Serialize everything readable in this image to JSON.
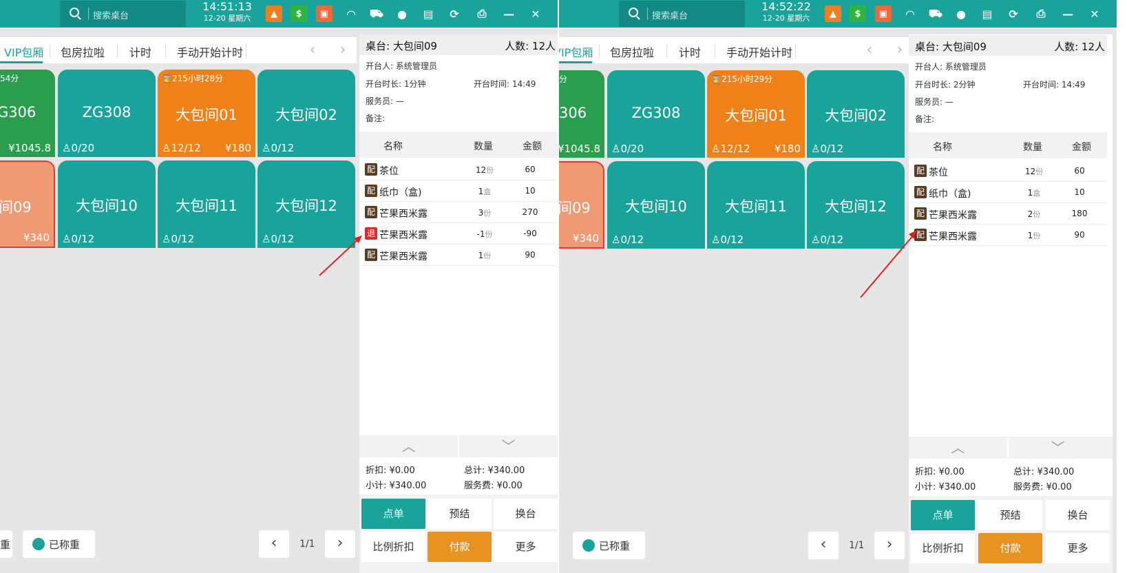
{
  "screens": [
    {
      "search_placeholder": "搜索桌台",
      "time": "14:51:13",
      "date": "12-20 星期六",
      "category_tabs": [
        "VIP包厢",
        "包房拉啦",
        "计时",
        "手动开始计时"
      ],
      "tiles": [
        {
          "name": "G306",
          "timer": "54分",
          "people": "",
          "amount": "¥1045.8"
        },
        {
          "name": "ZG308",
          "timer": "",
          "people": "0/20",
          "amount": ""
        },
        {
          "name": "大包间01",
          "timer": "215小时28分",
          "people": "12/12",
          "amount": "¥180"
        },
        {
          "name": "大包间02",
          "timer": "",
          "people": "0/12",
          "amount": ""
        },
        {
          "name": "间09",
          "timer": "",
          "people": "",
          "amount": "¥340"
        },
        {
          "name": "大包间10",
          "timer": "",
          "people": "0/12",
          "amount": ""
        },
        {
          "name": "大包间11",
          "timer": "",
          "people": "0/12",
          "amount": ""
        },
        {
          "name": "大包间12",
          "timer": "",
          "people": "0/12",
          "amount": ""
        }
      ],
      "chip_partial": "重",
      "chip_weighed": "已称重",
      "page": "1/1",
      "detail": {
        "table": "桌台: 大包间09",
        "guests": "人数: 12人",
        "opener": "开台人: 系统管理员",
        "duration": "开台时长: 1分钟",
        "open_time": "开台时间:  14:49",
        "waiter": "服务员: —",
        "note": "备注:",
        "col_name": "名称",
        "col_qty": "数量",
        "col_amount": "金额",
        "items": [
          {
            "tag": "配",
            "name": "茶位",
            "qty": "12",
            "unit": "份",
            "amount": "60"
          },
          {
            "tag": "配",
            "name": "纸巾（盒)",
            "qty": "1",
            "unit": "盒",
            "amount": "10"
          },
          {
            "tag": "配",
            "name": "芒果西米露",
            "qty": "3",
            "unit": "份",
            "amount": "270"
          },
          {
            "tag": "退",
            "name": "芒果西米露",
            "qty": "-1",
            "unit": "份",
            "amount": "-90"
          },
          {
            "tag": "配",
            "name": "芒果西米露",
            "qty": "1",
            "unit": "份",
            "amount": "90"
          }
        ],
        "discount": "折扣: ¥0.00",
        "total": "总计: ¥340.00",
        "subtotal": "小计: ¥340.00",
        "service_fee": "服务费: ¥0.00",
        "buttons": [
          "点单",
          "预结",
          "换台",
          "比例折扣",
          "付款",
          "更多"
        ]
      }
    },
    {
      "search_placeholder": "搜索桌台",
      "time": "14:52:22",
      "date": "12-20 星期六",
      "category_tabs": [
        "VIP包厢",
        "包房拉啦",
        "计时",
        "手动开始计时"
      ],
      "tiles": [
        {
          "name": "306",
          "timer": "分",
          "people": "",
          "amount": "¥1045.8"
        },
        {
          "name": "ZG308",
          "timer": "",
          "people": "0/20",
          "amount": ""
        },
        {
          "name": "大包间01",
          "timer": "215小时29分",
          "people": "12/12",
          "amount": "¥180"
        },
        {
          "name": "大包间02",
          "timer": "",
          "people": "0/12",
          "amount": ""
        },
        {
          "name": "间09",
          "timer": "",
          "people": "",
          "amount": "¥340"
        },
        {
          "name": "大包间10",
          "timer": "",
          "people": "0/12",
          "amount": ""
        },
        {
          "name": "大包间11",
          "timer": "",
          "people": "0/12",
          "amount": ""
        },
        {
          "name": "大包间12",
          "timer": "",
          "people": "0/12",
          "amount": ""
        }
      ],
      "chip_partial": "",
      "chip_weighed": "已称重",
      "page": "1/1",
      "detail": {
        "table": "桌台: 大包间09",
        "guests": "人数: 12人",
        "opener": "开台人: 系统管理员",
        "duration": "开台时长: 2分钟",
        "open_time": "开台时间:  14:49",
        "waiter": "服务员: —",
        "note": "备注:",
        "col_name": "名称",
        "col_qty": "数量",
        "col_amount": "金额",
        "items": [
          {
            "tag": "配",
            "name": "茶位",
            "qty": "12",
            "unit": "份",
            "amount": "60"
          },
          {
            "tag": "配",
            "name": "纸巾（盒)",
            "qty": "1",
            "unit": "盒",
            "amount": "10"
          },
          {
            "tag": "配",
            "name": "芒果西米露",
            "qty": "2",
            "unit": "份",
            "amount": "180"
          },
          {
            "tag": "配",
            "name": "芒果西米露",
            "qty": "1",
            "unit": "份",
            "amount": "90"
          }
        ],
        "discount": "折扣: ¥0.00",
        "total": "总计: ¥340.00",
        "subtotal": "小计: ¥340.00",
        "service_fee": "服务费: ¥0.00",
        "buttons": [
          "点单",
          "预结",
          "换台",
          "比例折扣",
          "付款",
          "更多"
        ]
      }
    }
  ],
  "colors": {
    "teal": "#1aa39a",
    "orange": "#f08119",
    "green": "#2a9d4e",
    "salmon": "#ef9a75",
    "return_tag": "#e02a2a",
    "annotation_arrow": "#e02020"
  }
}
